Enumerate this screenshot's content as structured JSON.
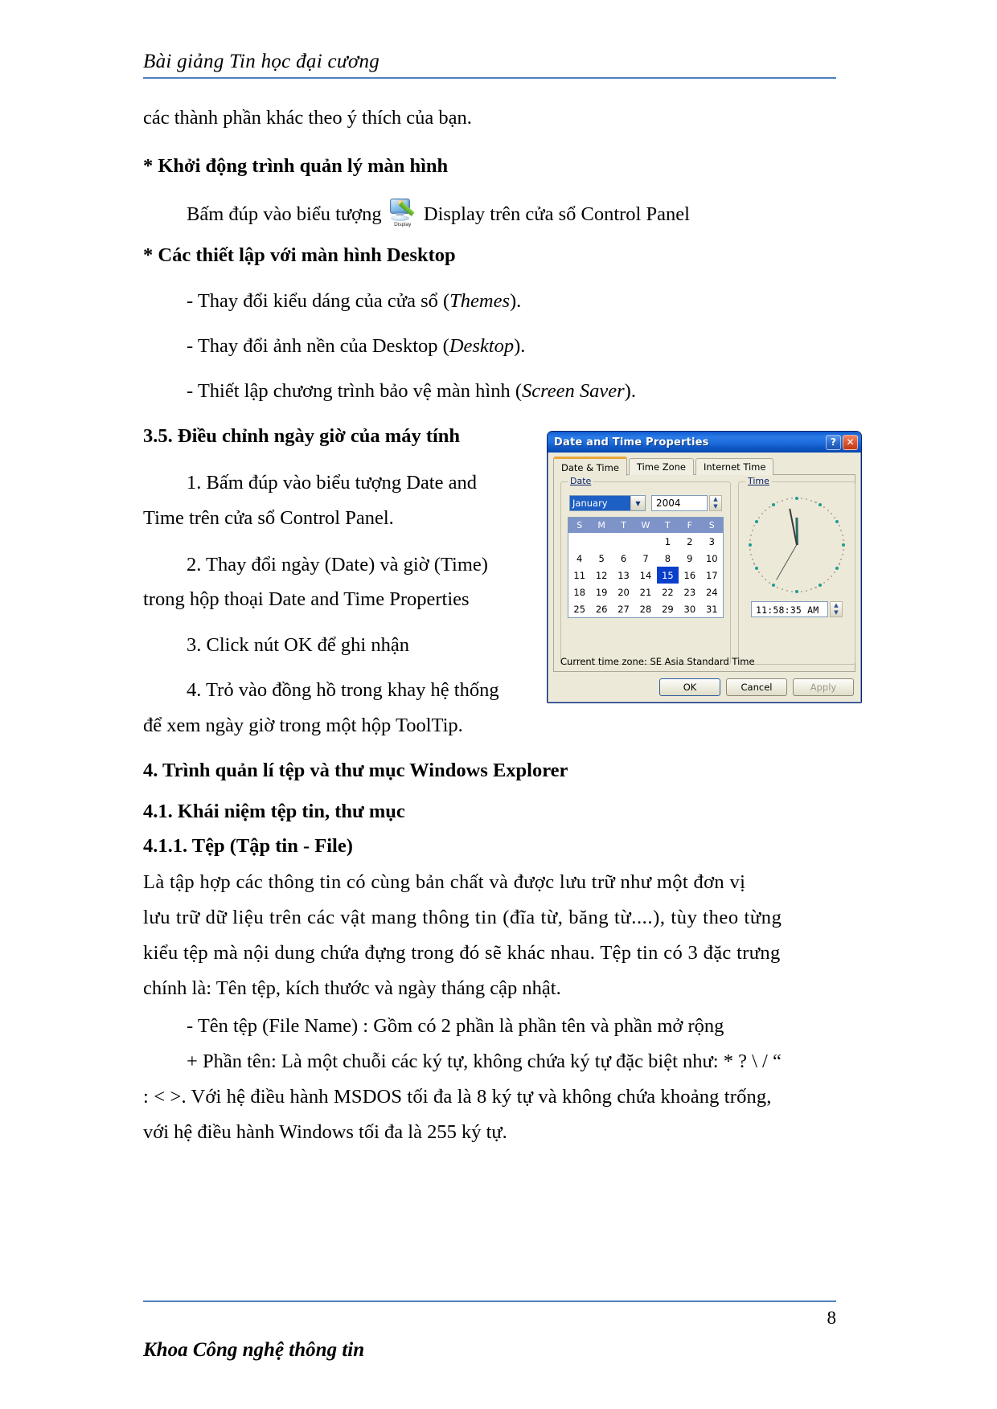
{
  "document": {
    "header_title": "Bài giảng Tin học đại cương",
    "footer_title": "Khoa Công nghệ thông tin",
    "page_number": "8",
    "accent_rule_color": "#4f81bd"
  },
  "body": {
    "line_1": "các thành phần khác theo ý thích của bạn.",
    "heading_1": "* Khởi động trình quản lý màn hình",
    "para_display_pre": "Bấm   đúp   vào   biểu   tượng",
    "display_icon_caption": "Display",
    "para_display_post": "Display  trên cửa sổ Control Panel",
    "heading_2": "* Các thiết lập với màn hình Desktop",
    "bullet_1_pre": "- Thay đổi kiểu dáng của cửa sổ (",
    "bullet_1_ital": "Themes",
    "bullet_1_post": ").",
    "bullet_2_pre": "- Thay đổi ảnh nền của Desktop (",
    "bullet_2_ital": "Desktop",
    "bullet_2_post": ").",
    "bullet_3_pre": "- Thiết lập chương trình bảo vệ màn hình (",
    "bullet_3_ital": "Screen Saver",
    "bullet_3_post": ").",
    "heading_3": "3.5. Điều chỉnh ngày giờ của máy tính",
    "step_1_line_1": "1. Bấm đúp vào biểu tượng Date and",
    "step_1_line_2": "Time trên cửa sổ Control Panel.",
    "step_2_line_1": "2. Thay đổi ngày (Date) và giờ (Time)",
    "step_2_line_2": "trong hộp thoại Date and Time Properties",
    "step_3": "3.  Click nút OK để ghi nhận",
    "step_4_line_1": "4. Trỏ vào đồng hồ trong khay hệ thống",
    "step_4_line_2": "để xem ngày giờ trong một hộp ToolTip.",
    "heading_4": "4. Trình quản lí tệp và thư mục Windows Explorer",
    "heading_5": "4.1. Khái niệm tệp tin, thư mục",
    "heading_6": "4.1.1. Tệp (Tập tin - File)",
    "para_file_l1": "Là tập hợp các thông tin có cùng bản chất và được lưu trữ như một đơn vị",
    "para_file_l2": "lưu trữ dữ liệu trên các vật mang thông tin (đĩa từ, băng từ....), tùy theo từng",
    "para_file_l3": "kiểu tệp mà nội dung chứa đựng trong đó sẽ khác nhau. Tệp tin có 3 đặc trưng",
    "para_file_l4": "chính là: Tên tệp, kích thước và ngày tháng cập nhật.",
    "para_name_l1": "- Tên tệp (File Name) : Gồm có 2 phần là phần tên và phần mở rộng",
    "para_name_l2": "+ Phần tên: Là một chuỗi các ký tự, không chứa ký tự đặc biệt như: * ? \\ / “",
    "para_name_l3": ": < >. Với hệ điều hành MSDOS tối đa là 8 ký tự và không chứa khoảng trống,",
    "para_name_l4": "với hệ điều hành Windows tối đa là 255 ký tự."
  },
  "dialog": {
    "title": "Date and Time Properties",
    "help_button": "?",
    "close_button": "✕",
    "tabs": [
      {
        "label": "Date & Time",
        "active": true
      },
      {
        "label": "Time Zone",
        "active": false
      },
      {
        "label": "Internet Time",
        "active": false
      }
    ],
    "date_group": {
      "label": "Date",
      "month_value": "January",
      "year_value": "2004",
      "weekday_headers": [
        "S",
        "M",
        "T",
        "W",
        "T",
        "F",
        "S"
      ],
      "weeks": [
        [
          "",
          "",
          "",
          "",
          "1",
          "2",
          "3"
        ],
        [
          "4",
          "5",
          "6",
          "7",
          "8",
          "9",
          "10"
        ],
        [
          "11",
          "12",
          "13",
          "14",
          "15",
          "16",
          "17"
        ],
        [
          "18",
          "19",
          "20",
          "21",
          "22",
          "23",
          "24"
        ],
        [
          "25",
          "26",
          "27",
          "28",
          "29",
          "30",
          "31"
        ]
      ],
      "selected_day": "15"
    },
    "time_group": {
      "label": "Time",
      "time_value": "11:58:35 AM",
      "clock_hour_angle": 359,
      "clock_minute_angle": 349,
      "clock_second_angle": 210
    },
    "timezone_text": "Current time zone:  SE Asia Standard Time",
    "buttons": {
      "ok": "OK",
      "cancel": "Cancel",
      "apply": "Apply"
    },
    "colors": {
      "titlebar_blue": "#1866d8",
      "face": "#ece9d8",
      "selection_blue": "#0a3fcc",
      "tab_accent": "#e9a638"
    }
  }
}
